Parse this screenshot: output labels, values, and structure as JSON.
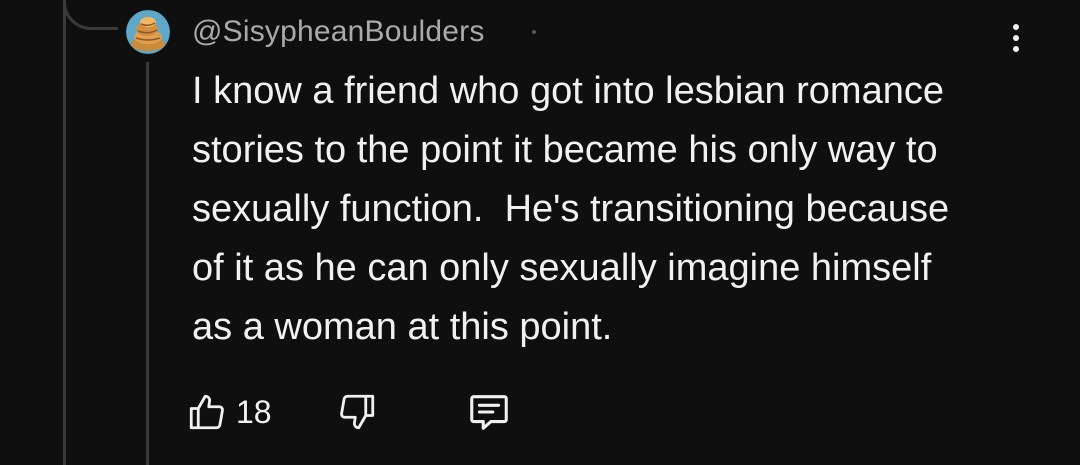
{
  "comment": {
    "handle": "@SisypheanBoulders",
    "avatar_icon": "avatar-icon",
    "lines": [
      "I know a friend who got into lesbian romance",
      "stories to the point it became his only way to",
      "sexually function.  He's transitioning because",
      "of it as he can only sexually imagine himself",
      "as a woman at this point."
    ]
  },
  "actions": {
    "like_icon": "thumbs-up-icon",
    "like_count": "18",
    "dislike_icon": "thumbs-down-icon",
    "reply_icon": "comment-icon"
  },
  "menu_icon": "more-vertical-icon",
  "colors": {
    "background": "#0f0f0f",
    "text": "#f1f1f1",
    "secondary_text": "#aaaaaa",
    "thread_line": "#3a3a3a"
  }
}
